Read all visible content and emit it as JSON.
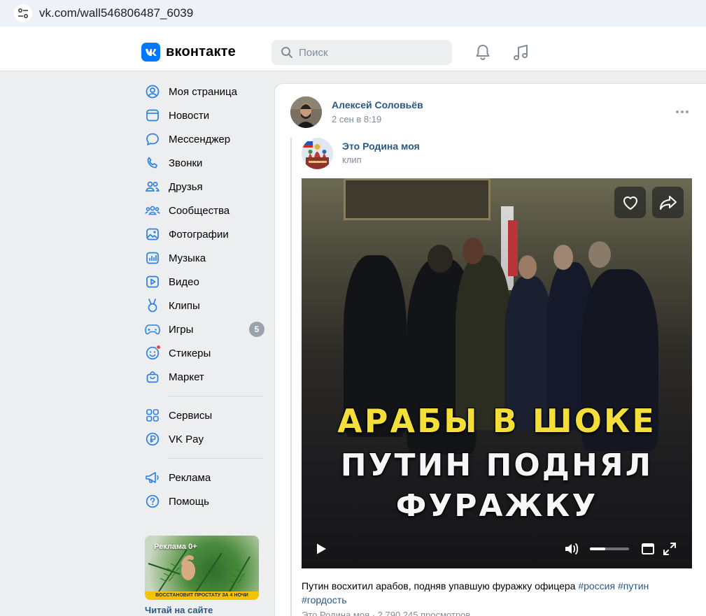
{
  "browser": {
    "url": "vk.com/wall546806487_6039"
  },
  "header": {
    "logo_text": "вконтакте",
    "search_placeholder": "Поиск"
  },
  "sidebar": {
    "items": [
      {
        "label": "Моя страница",
        "icon": "user-circle-icon"
      },
      {
        "label": "Новости",
        "icon": "news-icon"
      },
      {
        "label": "Мессенджер",
        "icon": "message-icon"
      },
      {
        "label": "Звонки",
        "icon": "phone-icon"
      },
      {
        "label": "Друзья",
        "icon": "friends-icon"
      },
      {
        "label": "Сообщества",
        "icon": "communities-icon"
      },
      {
        "label": "Фотографии",
        "icon": "photo-icon"
      },
      {
        "label": "Музыка",
        "icon": "music-icon"
      },
      {
        "label": "Видео",
        "icon": "video-icon"
      },
      {
        "label": "Клипы",
        "icon": "clips-icon"
      },
      {
        "label": "Игры",
        "icon": "games-icon",
        "badge": "5"
      },
      {
        "label": "Стикеры",
        "icon": "stickers-icon"
      },
      {
        "label": "Маркет",
        "icon": "market-icon"
      }
    ],
    "items2": [
      {
        "label": "Сервисы",
        "icon": "services-icon"
      },
      {
        "label": "VK Pay",
        "icon": "vkpay-icon"
      }
    ],
    "items3": [
      {
        "label": "Реклама",
        "icon": "megaphone-icon"
      },
      {
        "label": "Помощь",
        "icon": "help-icon"
      }
    ],
    "ad": {
      "label": "Реклама 0+",
      "strip_text": "ВОССТАНОВИТ ПРОСТАТУ ЗА 4 НОЧИ",
      "link": "Читай на сайте"
    }
  },
  "post": {
    "author": "Алексей Соловьёв",
    "time": "2 сен в 8:19",
    "repost": {
      "group": "Это Родина моя",
      "type": "клип"
    },
    "video": {
      "title_line1": "АРАБЫ В ШОКЕ",
      "title_line2": "ПУТИН ПОДНЯЛ",
      "title_line3": "ФУРАЖКУ",
      "volume": 0.4
    },
    "caption": "Путин восхитил арабов, подняв упавшую фуражку офицера ",
    "hashtags": [
      "#россия",
      "#путин",
      "#гордость"
    ],
    "source_line": "Это Родина моя · 2 790 245 просмотров"
  }
}
